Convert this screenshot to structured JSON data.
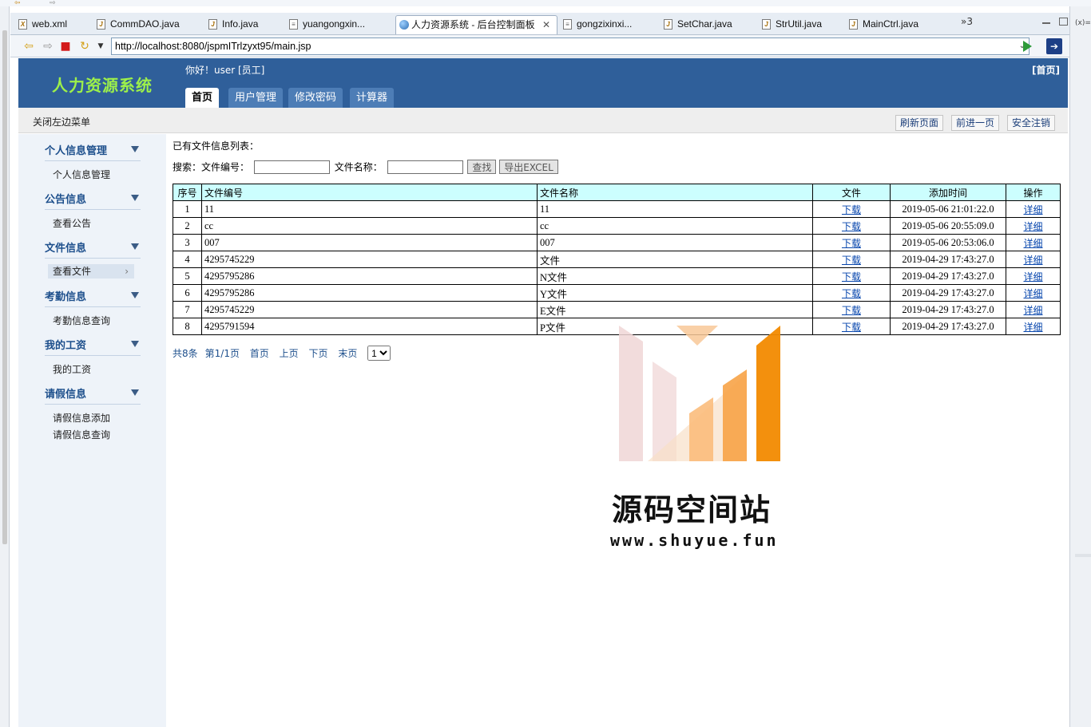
{
  "ide": {
    "editor_tabs": [
      {
        "label": "web.xml",
        "icon": "xml-file-icon"
      },
      {
        "label": "CommDAO.java",
        "icon": "java-file-icon"
      },
      {
        "label": "Info.java",
        "icon": "java-file-icon"
      },
      {
        "label": "yuangongxin...",
        "icon": "text-file-icon"
      },
      {
        "label": "人力资源系统 - 后台控制面板",
        "icon": "browser-globe-icon",
        "active": true
      },
      {
        "label": "gongzixinxi...",
        "icon": "text-file-icon"
      },
      {
        "label": "SetChar.java",
        "icon": "java-file-icon"
      },
      {
        "label": "StrUtil.java",
        "icon": "java-file-icon"
      },
      {
        "label": "MainCtrl.java",
        "icon": "java-file-icon"
      }
    ],
    "tab_overflow": "»3",
    "right_gutter_label": "(x)=",
    "url": "http://localhost:8080/jspmITrlzyxt95/main.jsp"
  },
  "header": {
    "site_title": "人力资源系统",
    "greeting": "你好！user [员工]",
    "home_link": "[首页]",
    "nav_tabs": [
      "首页",
      "用户管理",
      "修改密码",
      "计算器"
    ]
  },
  "subbar": {
    "close_menu": "关闭左边菜单",
    "buttons": [
      "刷新页面",
      "前进一页",
      "安全注销"
    ]
  },
  "sidebar": {
    "sections": [
      {
        "title": "个人信息管理",
        "items": [
          "个人信息管理"
        ]
      },
      {
        "title": "公告信息",
        "items": [
          "查看公告"
        ]
      },
      {
        "title": "文件信息",
        "items": [
          "查看文件"
        ]
      },
      {
        "title": "考勤信息",
        "items": [
          "考勤信息查询"
        ]
      },
      {
        "title": "我的工资",
        "items": [
          "我的工资"
        ]
      },
      {
        "title": "请假信息",
        "items": [
          "请假信息添加",
          "请假信息查询"
        ]
      }
    ]
  },
  "content": {
    "list_title": "已有文件信息列表：",
    "search": {
      "label": "搜索：",
      "field1_label": "文件编号：",
      "field1_value": "",
      "field2_label": "文件名称：",
      "field2_value": "",
      "search_button": "查找",
      "export_button": "导出EXCEL"
    },
    "table": {
      "headers": [
        "序号",
        "文件编号",
        "文件名称",
        "文件",
        "添加时间",
        "操作"
      ],
      "download_label": "下载",
      "detail_label": "详细",
      "rows": [
        {
          "no": "1",
          "code": "11",
          "name": "11",
          "time": "2019-05-06 21:01:22.0"
        },
        {
          "no": "2",
          "code": "cc",
          "name": "cc",
          "time": "2019-05-06 20:55:09.0"
        },
        {
          "no": "3",
          "code": "007",
          "name": "007",
          "time": "2019-05-06 20:53:06.0"
        },
        {
          "no": "4",
          "code": "4295745229",
          "name": "文件",
          "time": "2019-04-29 17:43:27.0"
        },
        {
          "no": "5",
          "code": "4295795286",
          "name": "N文件",
          "time": "2019-04-29 17:43:27.0"
        },
        {
          "no": "6",
          "code": "4295795286",
          "name": "Y文件",
          "time": "2019-04-29 17:43:27.0"
        },
        {
          "no": "7",
          "code": "4295745229",
          "name": "E文件",
          "time": "2019-04-29 17:43:27.0"
        },
        {
          "no": "8",
          "code": "4295791594",
          "name": "P文件",
          "time": "2019-04-29 17:43:27.0"
        }
      ]
    },
    "pager": {
      "total": "共8条",
      "page": "第1/1页",
      "first": "首页",
      "prev": "上页",
      "next": "下页",
      "last": "末页",
      "selected": "1"
    }
  },
  "watermark": {
    "text": "源码空间站",
    "url": "www.shuyue.fun"
  },
  "colors": {
    "header_bg": "#2f5f9a",
    "title_green": "#9df04a",
    "table_header_bg": "#ccfefe",
    "sidebar_bg": "#eef3f9",
    "watermark_orange": "#f28a00"
  }
}
